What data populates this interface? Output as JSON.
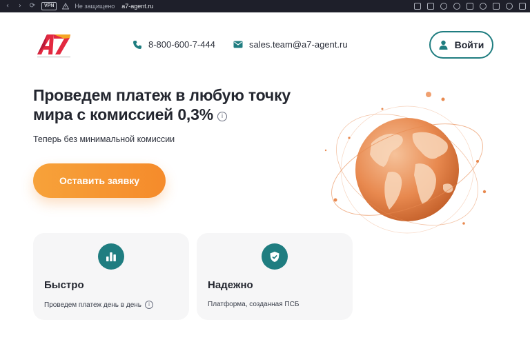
{
  "browser": {
    "vpn_label": "VPN",
    "insecure_label": "Не защищено",
    "url": "a7-agent.ru",
    "nav_icons": [
      "back-arrow-icon",
      "forward-arrow-icon",
      "reload-icon"
    ],
    "toolbar_icons": [
      "translate-icon",
      "camera-icon",
      "shield-icon",
      "share-icon",
      "send-icon",
      "heart-icon",
      "download-icon",
      "profile-icon",
      "extensions-icon"
    ]
  },
  "header": {
    "logo_text": "A7",
    "phone": "8-800-600-7-444",
    "email": "sales.team@a7-agent.ru",
    "login_label": "Войти"
  },
  "hero": {
    "title_line1": "Проведем платеж в любую точку",
    "title_line2": "мира с комиссией 0,3%",
    "info_glyph": "i",
    "subtitle": "Теперь без минимальной комиссии",
    "cta_label": "Оставить заявку"
  },
  "features": [
    {
      "icon": "bar-chart-icon",
      "title": "Быстро",
      "text": "Проведем платеж день в день",
      "has_info": true
    },
    {
      "icon": "check-shield-icon",
      "title": "Надежно",
      "text": "Платформа, созданная ПСБ",
      "has_info": false
    }
  ],
  "colors": {
    "accent_teal": "#1f7d80",
    "cta_orange": "#f58b2b",
    "globe_orange": "#e8894f",
    "browser_bar": "#1e1f2a"
  }
}
